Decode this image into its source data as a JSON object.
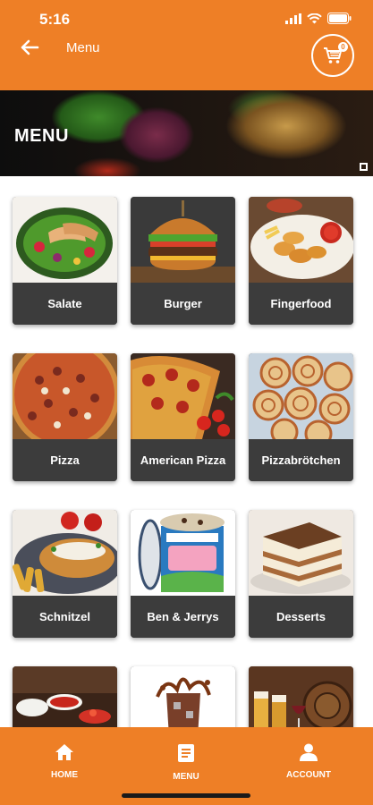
{
  "status": {
    "time": "5:16"
  },
  "header": {
    "title": "Menu",
    "cart_count": "0"
  },
  "hero": {
    "title": "MENU"
  },
  "categories": [
    {
      "label": "Salate",
      "icon": "salad-image"
    },
    {
      "label": "Burger",
      "icon": "burger-image"
    },
    {
      "label": "Fingerfood",
      "icon": "fingerfood-image"
    },
    {
      "label": "Pizza",
      "icon": "pizza-image"
    },
    {
      "label": "American Pizza",
      "icon": "american-pizza-image"
    },
    {
      "label": "Pizzabrötchen",
      "icon": "pizza-rolls-image"
    },
    {
      "label": "Schnitzel",
      "icon": "schnitzel-image"
    },
    {
      "label": "Ben & Jerrys",
      "icon": "ice-cream-image"
    },
    {
      "label": "Desserts",
      "icon": "tiramisu-image"
    },
    {
      "label": "",
      "icon": "dips-image"
    },
    {
      "label": "",
      "icon": "cola-splash-image"
    },
    {
      "label": "",
      "icon": "beer-drinks-image"
    }
  ],
  "bottom_nav": {
    "home": "HOME",
    "menu": "MENU",
    "account": "ACCOUNT"
  },
  "colors": {
    "accent": "#ee7f26",
    "card": "#3c3c3c"
  }
}
